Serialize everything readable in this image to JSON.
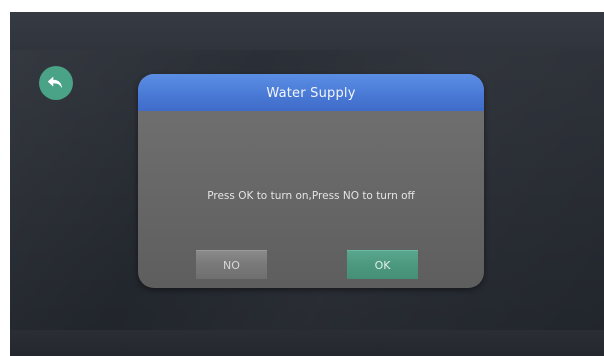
{
  "colors": {
    "accent_green": "#4aa386",
    "header_blue": "#4a7ad6",
    "dialog_gray": "#6a6a6a",
    "screen_dark": "#262a31"
  },
  "back_button": {
    "icon": "undo-arrow-icon"
  },
  "dialog": {
    "title": "Water Supply",
    "message": "Press OK to turn on,Press NO to turn off",
    "no_label": "NO",
    "ok_label": "OK"
  }
}
